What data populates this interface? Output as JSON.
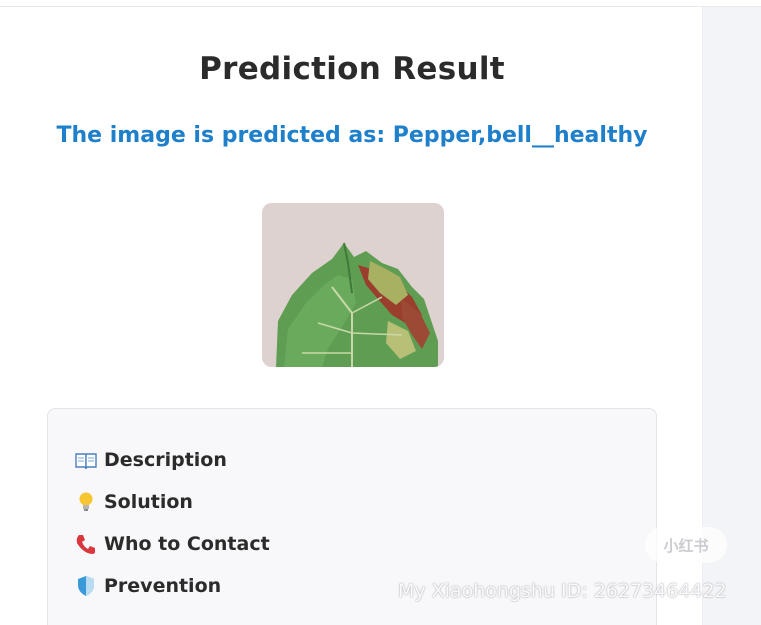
{
  "result": {
    "title": "Prediction Result",
    "prediction_text": "The image is predicted as: Pepper,bell__healthy"
  },
  "image": {
    "subject": "leaf-photo"
  },
  "info": {
    "items": [
      {
        "icon": "book-icon",
        "label": "Description"
      },
      {
        "icon": "lightbulb-icon",
        "label": "Solution"
      },
      {
        "icon": "phone-icon",
        "label": "Who to Contact"
      },
      {
        "icon": "shield-icon",
        "label": "Prevention"
      }
    ]
  },
  "watermark": {
    "badge": "小红书",
    "id_text": "My Xiaohongshu ID: 26273464422"
  },
  "colors": {
    "accent": "#1e7fcb",
    "title": "#2b2b2b",
    "box_bg": "#f8f8fa"
  }
}
